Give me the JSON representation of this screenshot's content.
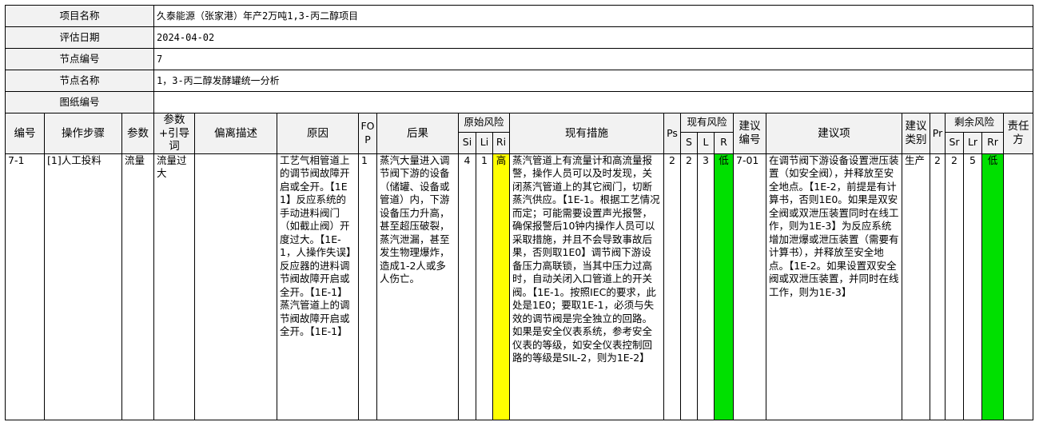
{
  "info": [
    {
      "label": "项目名称",
      "value": "久泰能源（张家港）年产2万吨1,3-丙二醇项目"
    },
    {
      "label": "评估日期",
      "value": "2024-04-02"
    },
    {
      "label": "节点编号",
      "value": "7"
    },
    {
      "label": "节点名称",
      "value": "1，3-丙二醇发酵罐统一分析"
    },
    {
      "label": "图纸编号",
      "value": ""
    }
  ],
  "headers": {
    "num": "编号",
    "step": "操作步骤",
    "param": "参数",
    "guideword": "参数+引导词",
    "deviation": "偏离描述",
    "cause": "原因",
    "fop": "FOP",
    "consequence": "后果",
    "orig_risk": "原始风险",
    "si": "Si",
    "li": "Li",
    "ri": "Ri",
    "measures": "现有措施",
    "ps": "Ps",
    "curr_risk": "现有风险",
    "s": "S",
    "l": "L",
    "r": "R",
    "rec_num": "建议编号",
    "rec": "建议项",
    "rec_type": "建议类别",
    "pr": "Pr",
    "rem_risk": "剩余风险",
    "sr": "Sr",
    "lr": "Lr",
    "rr": "Rr",
    "owner": "责任方"
  },
  "row": {
    "num": "7-1",
    "step": "[1]人工投料",
    "param": "流量",
    "guideword": "流量过大",
    "deviation": "",
    "cause": "工艺气相管道上的调节阀故障开启或全开。【1E1】反应系统的手动进料阀门（如截止阀）开度过大。【1E-1，人操作失误】反应器的进料调节阀故障开启或全开。【1E-1】蒸汽管道上的调节阀故障开启或全开。【1E-1】",
    "fop": "1",
    "consequence": "蒸汽大量进入调节阀下游的设备（储罐、设备或管道）内，下游设备压力升高，甚至超压破裂，蒸汽泄漏，甚至发生物理爆炸，造成1-2人或多人伤亡。",
    "si": "4",
    "li": "1",
    "ri": "高",
    "measures": "蒸汽管道上有流量计和高流量报警，操作人员可以及时发现，关闭蒸汽管道上的其它阀门，切断蒸汽供应。【1E-1。根据工艺情况而定；可能需要设置声光报警，确保报警后10钟内操作人员可以采取措施，并且不会导致事故后果，否则取1E0】调节阀下游设备压力高联锁，当其中压力过高时，自动关闭入口管道上的开关阀。【1E-1。按照IEC的要求，此处是1E0；要取1E-1，必须与失效的调节阀是完全独立的回路。如果是安全仪表系统，参考安全仪表的等级，如安全仪表控制回路的等级是SIL-2，则为1E-2】",
    "ps": "2",
    "s": "2",
    "l": "3",
    "r": "低",
    "rec_num": "7-01",
    "rec": "在调节阀下游设备设置泄压装置（如安全阀），并释放至安全地点。【1E-2，前提是有计算书，否则1E0。如果是双安全阀或双泄压装置同时在线工作，则为1E-3】为反应系统增加泄爆或泄压装置（需要有计算书），并释放至安全地点。【1E-2。如果设置双安全阀或双泄压装置，并同时在线工作，则为1E-3】",
    "rec_type": "生产",
    "pr": "2",
    "sr": "2",
    "lr": "5",
    "rr": "低",
    "owner": ""
  },
  "colors": {
    "high_risk": "#ffff00",
    "low_risk": "#00e000",
    "header_bg": "#f2f2f2"
  }
}
